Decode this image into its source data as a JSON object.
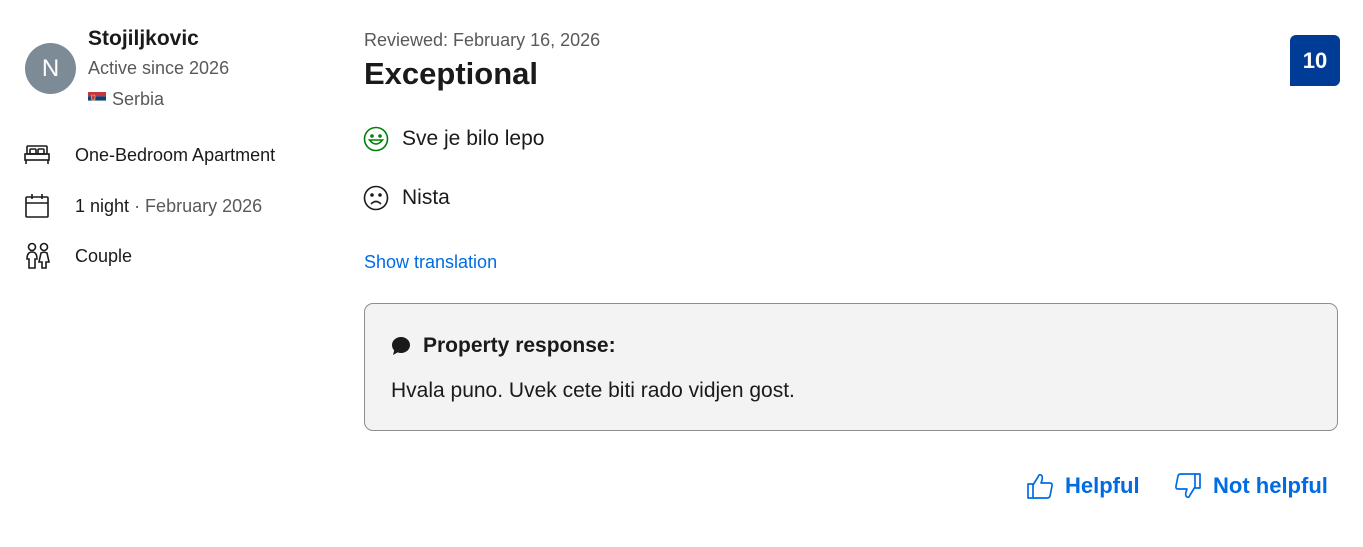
{
  "reviewer": {
    "avatar_initial": "N",
    "name": "Stojiljkovic",
    "since": "Active since 2026",
    "country": "Serbia"
  },
  "stay": {
    "room": "One-Bedroom Apartment",
    "nights": "1 night",
    "date": "· February 2026",
    "traveler_type": "Couple"
  },
  "review": {
    "reviewed_date": "Reviewed: February 16, 2026",
    "title": "Exceptional",
    "score": "10",
    "positive": "Sve je bilo lepo",
    "negative": "Nista",
    "show_translation": "Show translation"
  },
  "response": {
    "heading": "Property response:",
    "text": "Hvala puno. Uvek cete biti rado vidjen gost."
  },
  "feedback": {
    "helpful": "Helpful",
    "not_helpful": "Not helpful"
  },
  "colors": {
    "accent": "#006ce4",
    "score_bg": "#003b95",
    "positive_icon": "#008009",
    "response_bg": "#f3f3f3"
  }
}
